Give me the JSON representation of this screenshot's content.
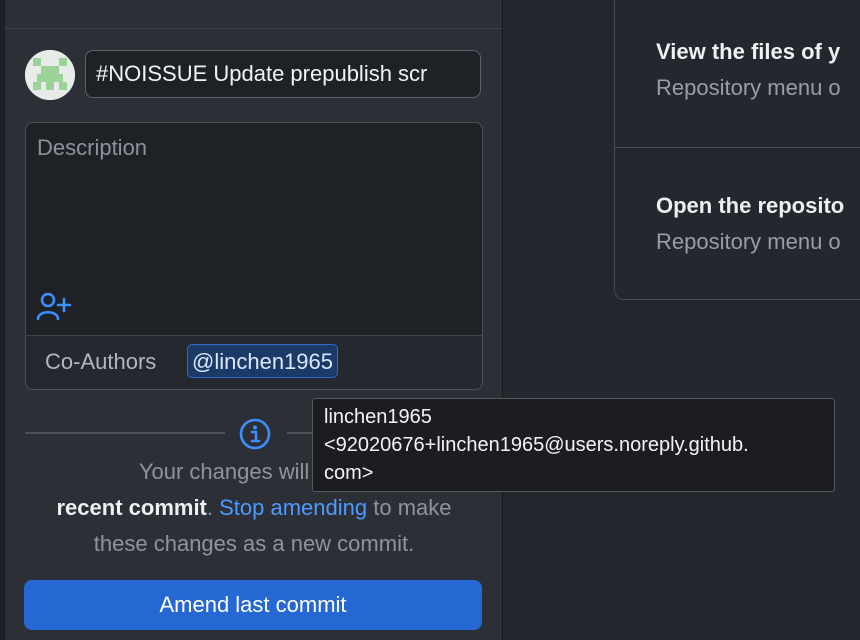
{
  "commit": {
    "summary_value": "#NOISSUE Update prepublish scr",
    "description_placeholder": "Description",
    "coauthors_label": "Co-Authors",
    "coauthor_handle": "@linchen1965"
  },
  "tooltip": {
    "line1": "linchen1965",
    "line2": "<92020676+linchen1965@users.noreply.github.",
    "line3": "com>"
  },
  "notice": {
    "part1": "Your changes will modif",
    "bold": "recent commit",
    "sep": ". ",
    "link": "Stop amending",
    "part2": " to make",
    "part3": "these changes as a new commit."
  },
  "actions": {
    "amend_label": "Amend last commit"
  },
  "cards": [
    {
      "title": "View the files of y",
      "subtitle": "Repository menu o"
    },
    {
      "title": "Open the reposito",
      "subtitle": "Repository menu o"
    }
  ],
  "colors": {
    "accent": "#2568d4",
    "link": "#4d9aff",
    "info_icon": "#3d8eff"
  },
  "icons": {
    "add_coauthor": "person-add-icon",
    "info": "info-icon"
  }
}
